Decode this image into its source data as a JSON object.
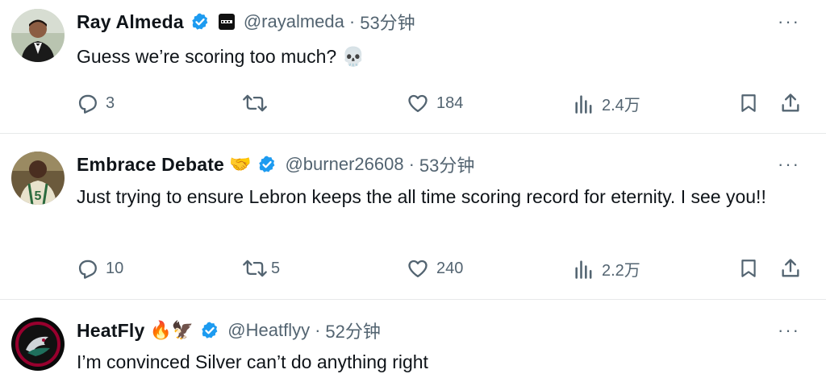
{
  "tweets": [
    {
      "name": "Ray Almeda",
      "handle": "@rayalmeda",
      "time": "53分钟",
      "dot": "·",
      "text": "Guess we’re scoring too much? 💀",
      "more": "···",
      "replies": "3",
      "retweets": "",
      "likes": "184",
      "views": "2.4万"
    },
    {
      "name": "Embrace Debate",
      "name_emoji": "🤝",
      "handle": "@burner26608",
      "time": "53分钟",
      "dot": "·",
      "text": "Just trying to ensure Lebron keeps the all time scoring record for eternity. I see you!!",
      "more": "···",
      "replies": "10",
      "retweets": "5",
      "likes": "240",
      "views": "2.2万"
    },
    {
      "name": "HeatFly",
      "name_emoji": "🔥🦅",
      "handle": "@Heatflyy",
      "time": "52分钟",
      "dot": "·",
      "text": "I’m convinced Silver can’t do anything right",
      "more": "···"
    }
  ],
  "colors": {
    "verified": "#1d9bf0",
    "secondary_text": "#536471",
    "primary_text": "#0f1419"
  },
  "avatar_jersey_number": "5"
}
